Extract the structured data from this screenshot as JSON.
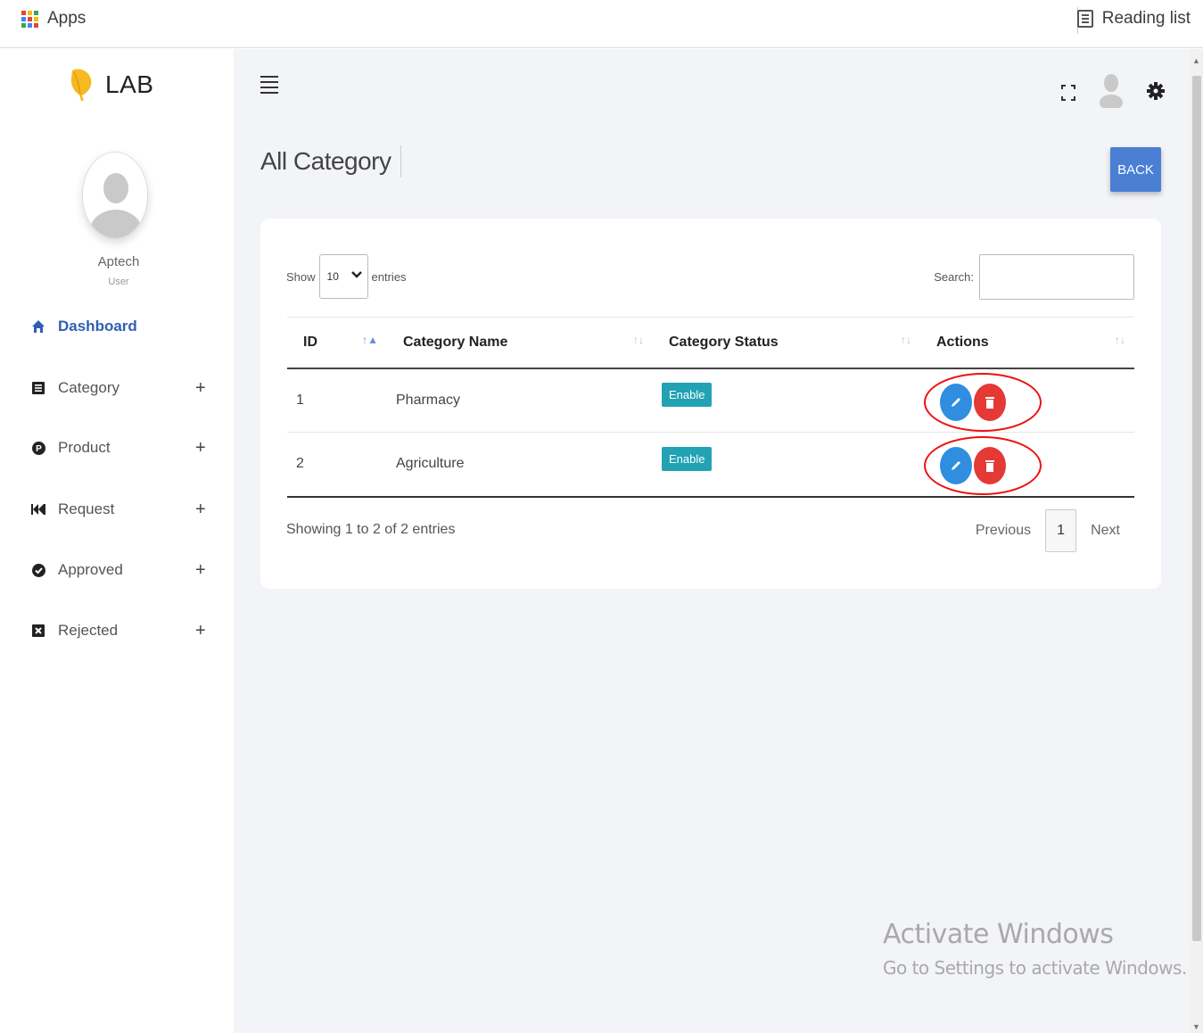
{
  "browser": {
    "apps_label": "Apps",
    "reading_list_label": "Reading list"
  },
  "sidebar": {
    "logo_text": "LAB",
    "user_name": "Aptech",
    "user_role": "User",
    "items": [
      {
        "label": "Dashboard",
        "icon": "home-icon",
        "active": true,
        "expandable": false
      },
      {
        "label": "Category",
        "icon": "list-icon",
        "expandable": true
      },
      {
        "label": "Product",
        "icon": "product-p-icon",
        "expandable": true
      },
      {
        "label": "Request",
        "icon": "fast-forward-icon",
        "expandable": true
      },
      {
        "label": "Approved",
        "icon": "check-circle-icon",
        "expandable": true
      },
      {
        "label": "Rejected",
        "icon": "x-square-icon",
        "expandable": true
      }
    ],
    "plus_symbol": "+"
  },
  "header": {
    "page_title": "All Category",
    "back_label": "BACK"
  },
  "table_controls": {
    "show_label": "Show",
    "show_value": "10",
    "entries_label": "entries",
    "search_label": "Search:",
    "search_value": ""
  },
  "table": {
    "columns": [
      "ID",
      "Category Name",
      "Category Status",
      "Actions"
    ],
    "rows": [
      {
        "id": "1",
        "name": "Pharmacy",
        "status": "Enable"
      },
      {
        "id": "2",
        "name": "Agriculture",
        "status": "Enable"
      }
    ]
  },
  "footer": {
    "info": "Showing 1 to 2 of 2 entries",
    "previous_label": "Previous",
    "page": "1",
    "next_label": "Next"
  },
  "watermark": {
    "title": "Activate Windows",
    "subtitle": "Go to Settings to activate Windows."
  },
  "colors": {
    "accent": "#4a7fd4",
    "badge": "#21a3b3",
    "edit": "#2f8ee0",
    "delete": "#e53935",
    "highlight_ring": "#e11111",
    "background": "#f3f4f7"
  }
}
